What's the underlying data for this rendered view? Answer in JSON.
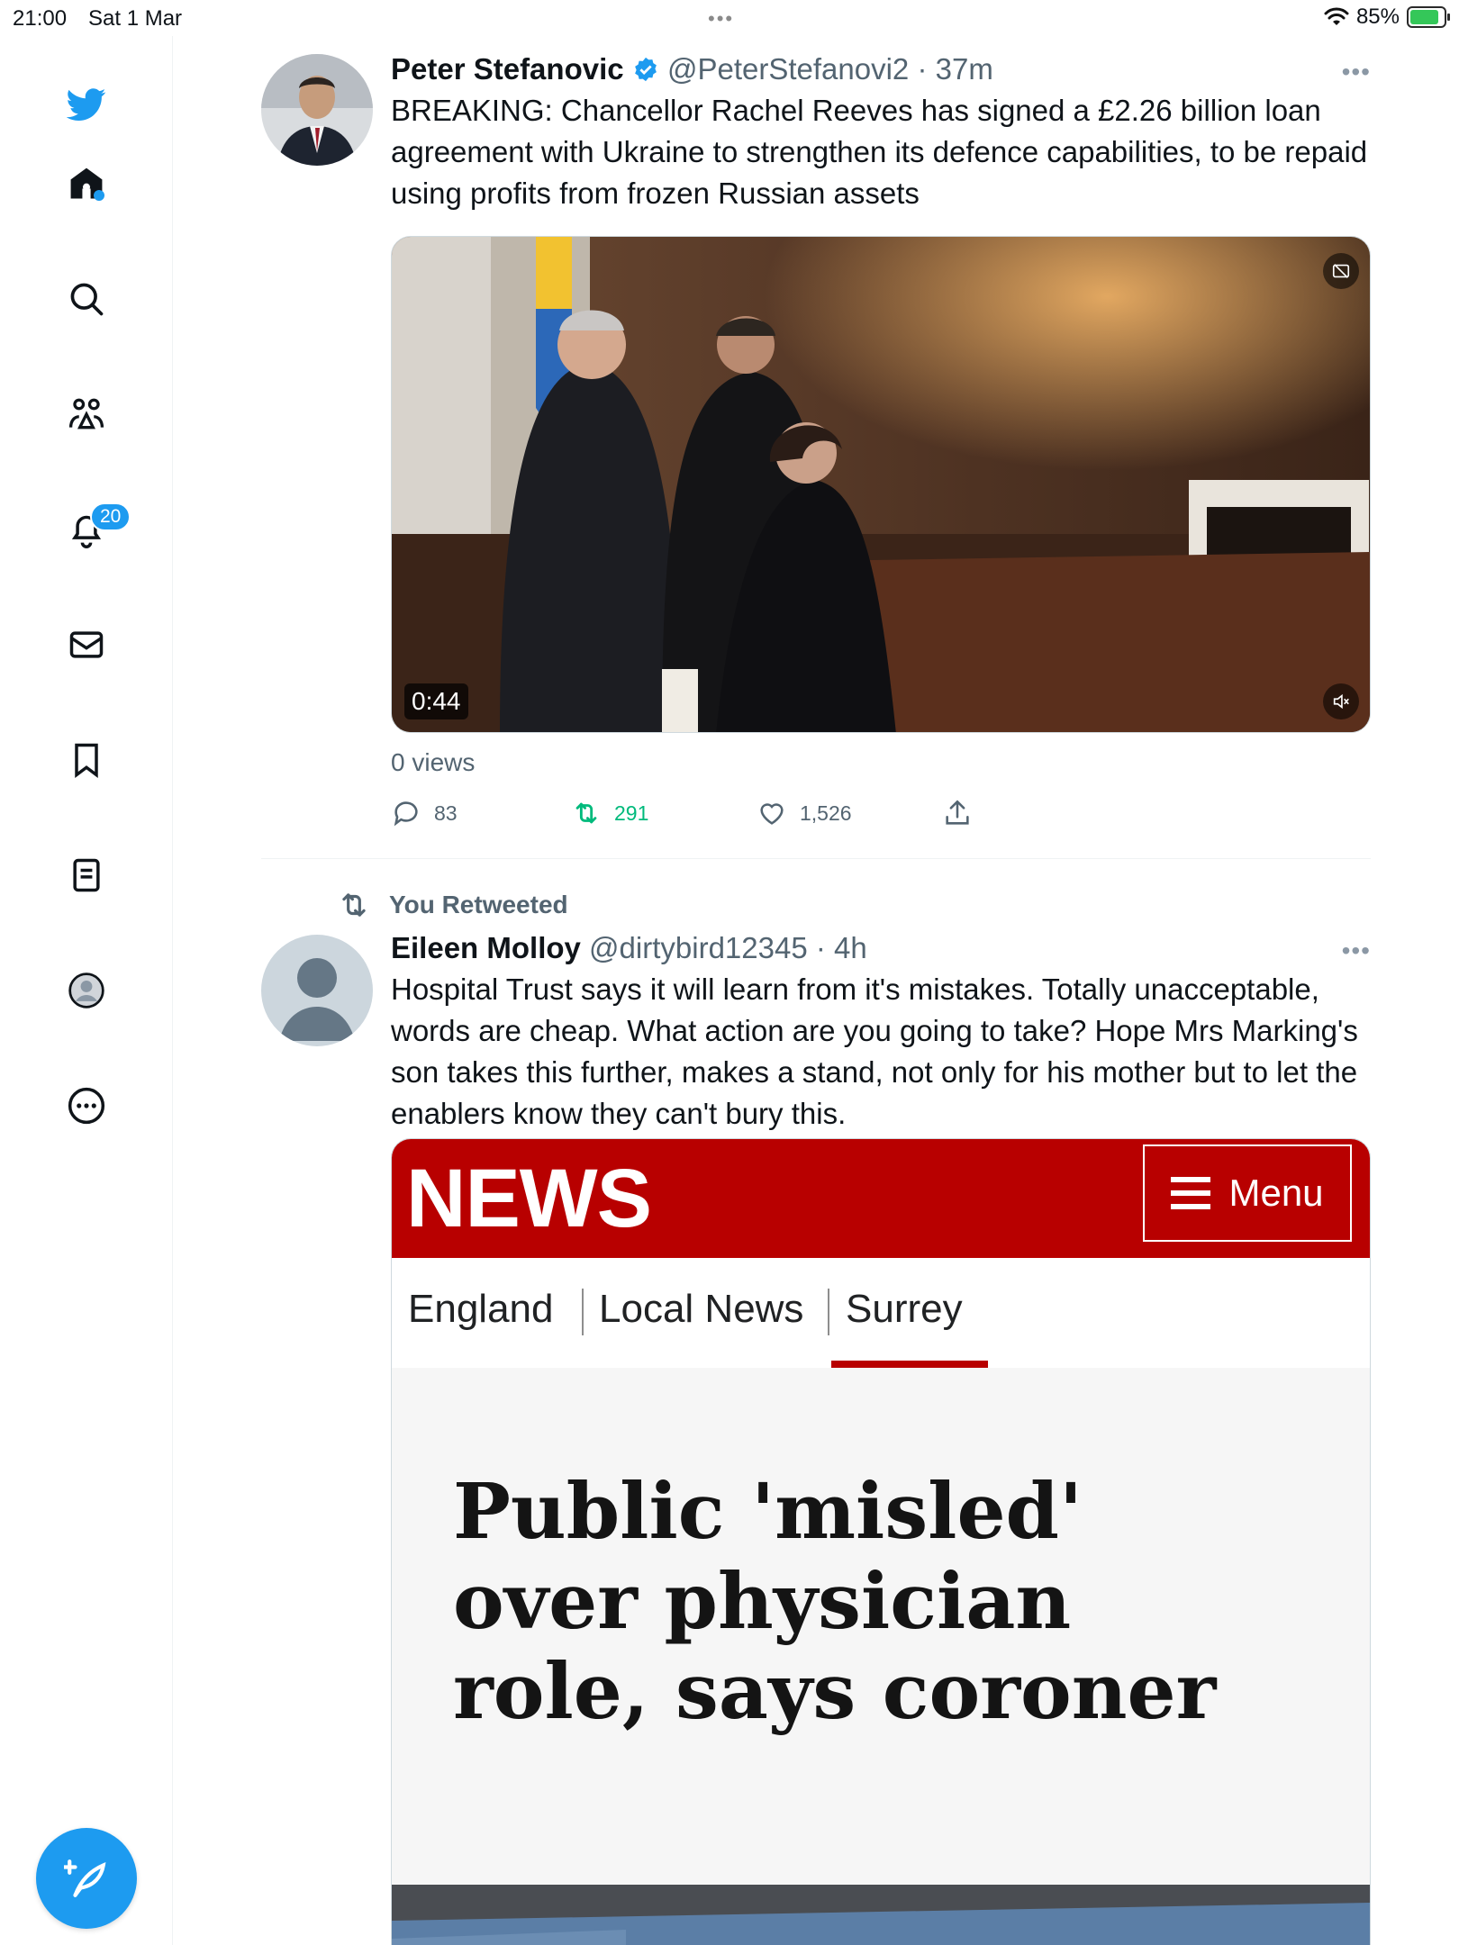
{
  "status_bar": {
    "time": "21:00",
    "date": "Sat 1 Mar",
    "battery": "85%",
    "battery_level": 0.85
  },
  "sidebar": {
    "notifications_badge": "20",
    "items": [
      "twitter-logo-icon",
      "home-icon",
      "search-icon",
      "communities-icon",
      "notifications-icon",
      "messages-icon",
      "bookmarks-icon",
      "lists-icon",
      "profile-icon",
      "more-icon"
    ]
  },
  "tweets": [
    {
      "name": "Peter Stefanovic",
      "verified": true,
      "handle": "@PeterStefanovi2",
      "time": "· 37m",
      "text": "BREAKING: Chancellor Rachel Reeves has signed a £2.26 billion loan agreement with Ukraine to strengthen its defence capabilities, to be repaid using profits from frozen Russian assets",
      "video_duration": "0:44",
      "views": "0 views",
      "replies": "83",
      "retweets": "291",
      "likes": "1,526"
    },
    {
      "retweet_label": "You Retweeted",
      "name": "Eileen Molloy",
      "handle": "@dirtybird12345",
      "time": "· 4h",
      "text": "Hospital Trust says it will learn from it's mistakes. Totally unacceptable, words are cheap. What action are you going to take? Hope  Mrs Marking's son takes this further, makes a stand, not only for his mother but to let the enablers know they can't bury this."
    }
  ],
  "bbc": {
    "logo": "NEWS",
    "menu": "Menu",
    "nav": [
      "England",
      "Local News",
      "Surrey"
    ],
    "headline": "Public 'misled' over physician role, says coroner"
  },
  "colors": {
    "accent": "#1d9bf0",
    "retweet_green": "#00ba7c",
    "bbc_red": "#b80000"
  }
}
